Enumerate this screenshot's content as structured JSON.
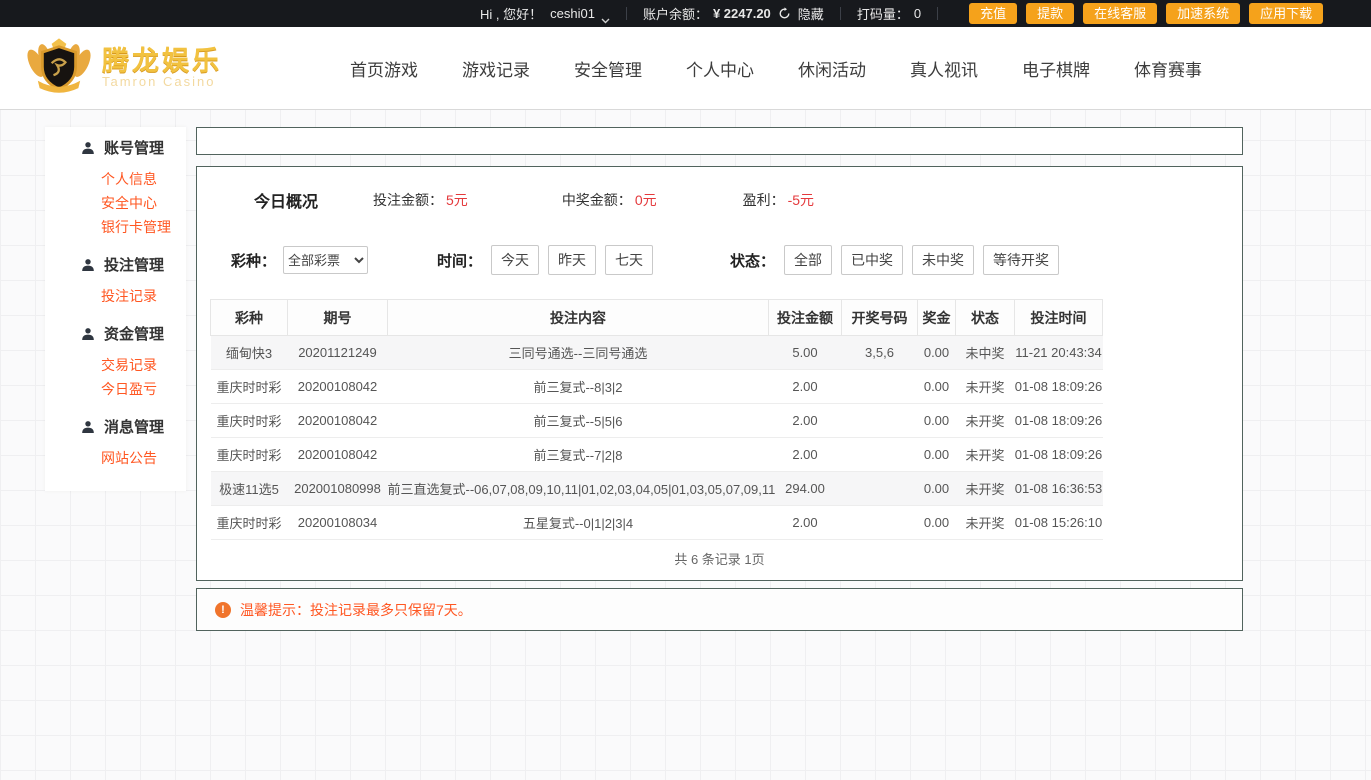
{
  "topbar": {
    "greeting": "Hi , 您好！",
    "username": "ceshi01",
    "balance_label": "账户余额：",
    "balance": "¥ 2247.20",
    "hide_label": "隐藏",
    "turnover_label": "打码量：",
    "turnover": "0",
    "buttons": [
      {
        "name": "recharge",
        "label": "充值"
      },
      {
        "name": "withdraw",
        "label": "提款"
      },
      {
        "name": "online-service",
        "label": "在线客服"
      },
      {
        "name": "speed-system",
        "label": "加速系统"
      },
      {
        "name": "app-download",
        "label": "应用下载"
      }
    ]
  },
  "header": {
    "logo_title": "腾龙娱乐",
    "logo_subtitle": "Tamron Casino",
    "nav": [
      {
        "name": "home-games",
        "label": "首页游戏"
      },
      {
        "name": "game-records",
        "label": "游戏记录"
      },
      {
        "name": "security-management",
        "label": "安全管理"
      },
      {
        "name": "personal-center",
        "label": "个人中心"
      },
      {
        "name": "leisure-activities",
        "label": "休闲活动"
      },
      {
        "name": "live-video",
        "label": "真人视讯"
      },
      {
        "name": "board-games",
        "label": "电子棋牌"
      },
      {
        "name": "sports-events",
        "label": "体育赛事"
      }
    ]
  },
  "sidebar": {
    "sections": [
      {
        "name": "account-management",
        "title": "账号管理",
        "items": [
          {
            "name": "personal-info",
            "label": "个人信息"
          },
          {
            "name": "security-center",
            "label": "安全中心"
          },
          {
            "name": "bank-card-management",
            "label": "银行卡管理"
          }
        ]
      },
      {
        "name": "bet-management",
        "title": "投注管理",
        "items": [
          {
            "name": "bet-records",
            "label": "投注记录"
          }
        ]
      },
      {
        "name": "funds-management",
        "title": "资金管理",
        "items": [
          {
            "name": "transaction-records",
            "label": "交易记录"
          },
          {
            "name": "today-profit",
            "label": "今日盈亏"
          }
        ]
      },
      {
        "name": "message-management",
        "title": "消息管理",
        "items": [
          {
            "name": "site-announcements",
            "label": "网站公告"
          }
        ]
      }
    ]
  },
  "overview": {
    "title": "今日概况",
    "stats": [
      {
        "name": "bet-amount",
        "label": "投注金额：",
        "value": "5元"
      },
      {
        "name": "win-amount",
        "label": "中奖金额：",
        "value": "0元"
      },
      {
        "name": "profit",
        "label": "盈利：",
        "value": "-5元"
      }
    ]
  },
  "filters": {
    "lottery_label": "彩种：",
    "lottery_selected": "全部彩票",
    "time_label": "时间：",
    "time_options": [
      {
        "name": "today",
        "label": "今天"
      },
      {
        "name": "yesterday",
        "label": "昨天"
      },
      {
        "name": "seven-days",
        "label": "七天"
      }
    ],
    "status_label": "状态：",
    "status_options": [
      {
        "name": "all",
        "label": "全部"
      },
      {
        "name": "won",
        "label": "已中奖"
      },
      {
        "name": "lost",
        "label": "未中奖"
      },
      {
        "name": "waiting-draw",
        "label": "等待开奖"
      }
    ]
  },
  "table": {
    "columns": [
      "彩种",
      "期号",
      "投注内容",
      "投注金额",
      "开奖号码",
      "奖金",
      "状态",
      "投注时间"
    ],
    "rows": [
      {
        "lottery": "缅甸快3",
        "issue": "20201121249",
        "content": "三同号通选--三同号通选",
        "amount": "5.00",
        "result": "3,5,6",
        "prize": "0.00",
        "status": "未中奖",
        "status_type": "lost",
        "time": "11-21 20:43:34"
      },
      {
        "lottery": "重庆时时彩",
        "issue": "20200108042",
        "content": "前三复式--8|3|2",
        "amount": "2.00",
        "result": "",
        "prize": "0.00",
        "status": "未开奖",
        "status_type": "pending",
        "time": "01-08 18:09:26"
      },
      {
        "lottery": "重庆时时彩",
        "issue": "20200108042",
        "content": "前三复式--5|5|6",
        "amount": "2.00",
        "result": "",
        "prize": "0.00",
        "status": "未开奖",
        "status_type": "pending",
        "time": "01-08 18:09:26"
      },
      {
        "lottery": "重庆时时彩",
        "issue": "20200108042",
        "content": "前三复式--7|2|8",
        "amount": "2.00",
        "result": "",
        "prize": "0.00",
        "status": "未开奖",
        "status_type": "pending",
        "time": "01-08 18:09:26"
      },
      {
        "lottery": "极速11选5",
        "issue": "202001080998",
        "content": "前三直选复式--06,07,08,09,10,11|01,02,03,04,05|01,03,05,07,09,11",
        "amount": "294.00",
        "result": "",
        "prize": "0.00",
        "status": "未开奖",
        "status_type": "pending",
        "time": "01-08 16:36:53"
      },
      {
        "lottery": "重庆时时彩",
        "issue": "20200108034",
        "content": "五星复式--0|1|2|3|4",
        "amount": "2.00",
        "result": "",
        "prize": "0.00",
        "status": "未开奖",
        "status_type": "pending",
        "time": "01-08 15:26:10"
      }
    ],
    "pagination": "共 6 条记录 1页"
  },
  "notice": {
    "text": "温馨提示：投注记录最多只保留7天。"
  },
  "colors": {
    "topbar_bg": "#17191d",
    "accent_orange": "#f5a21b",
    "link_orange": "#ff5722",
    "value_red": "#e4393c",
    "status_green": "#4caf50",
    "panel_border": "#51635d"
  }
}
